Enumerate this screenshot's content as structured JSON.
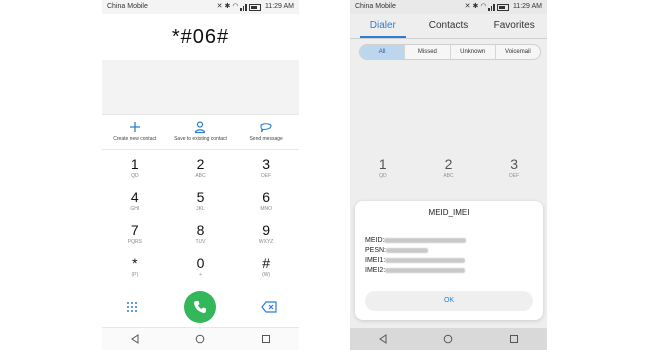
{
  "status_bar": {
    "carrier": "China Mobile",
    "time": "11:29 AM"
  },
  "left_phone": {
    "dialed_number": "*#06#",
    "actions": [
      {
        "label": "Create new contact",
        "icon": "plus-icon"
      },
      {
        "label": "Save to existing contact",
        "icon": "person-icon"
      },
      {
        "label": "Send message",
        "icon": "message-icon"
      }
    ],
    "keys": [
      {
        "digit": "1",
        "letters": "QD"
      },
      {
        "digit": "2",
        "letters": "ABC"
      },
      {
        "digit": "3",
        "letters": "DEF"
      },
      {
        "digit": "4",
        "letters": "GHI"
      },
      {
        "digit": "5",
        "letters": "JKL"
      },
      {
        "digit": "6",
        "letters": "MNO"
      },
      {
        "digit": "7",
        "letters": "PQRS"
      },
      {
        "digit": "8",
        "letters": "TUV"
      },
      {
        "digit": "9",
        "letters": "WXYZ"
      },
      {
        "digit": "*",
        "letters": "(P)"
      },
      {
        "digit": "0",
        "letters": "+"
      },
      {
        "digit": "#",
        "letters": "(W)"
      }
    ],
    "colors": {
      "call_green": "#34b65a",
      "accent_blue": "#2b7fd3"
    }
  },
  "right_phone": {
    "tabs": [
      {
        "label": "Dialer",
        "active": true
      },
      {
        "label": "Contacts",
        "active": false
      },
      {
        "label": "Favorites",
        "active": false
      }
    ],
    "filters": [
      {
        "label": "All",
        "active": true
      },
      {
        "label": "Missed",
        "active": false
      },
      {
        "label": "Unknown",
        "active": false
      },
      {
        "label": "Voicemail",
        "active": false
      }
    ],
    "keys": [
      {
        "digit": "1",
        "letters": "QD"
      },
      {
        "digit": "2",
        "letters": "ABC"
      },
      {
        "digit": "3",
        "letters": "DEF"
      }
    ],
    "dialog": {
      "title": "MEID_IMEI",
      "lines": [
        {
          "label": "MEID:"
        },
        {
          "label": "PESN:"
        },
        {
          "label": "IMEI1:"
        },
        {
          "label": "IMEI2:"
        }
      ],
      "ok_label": "OK"
    }
  }
}
